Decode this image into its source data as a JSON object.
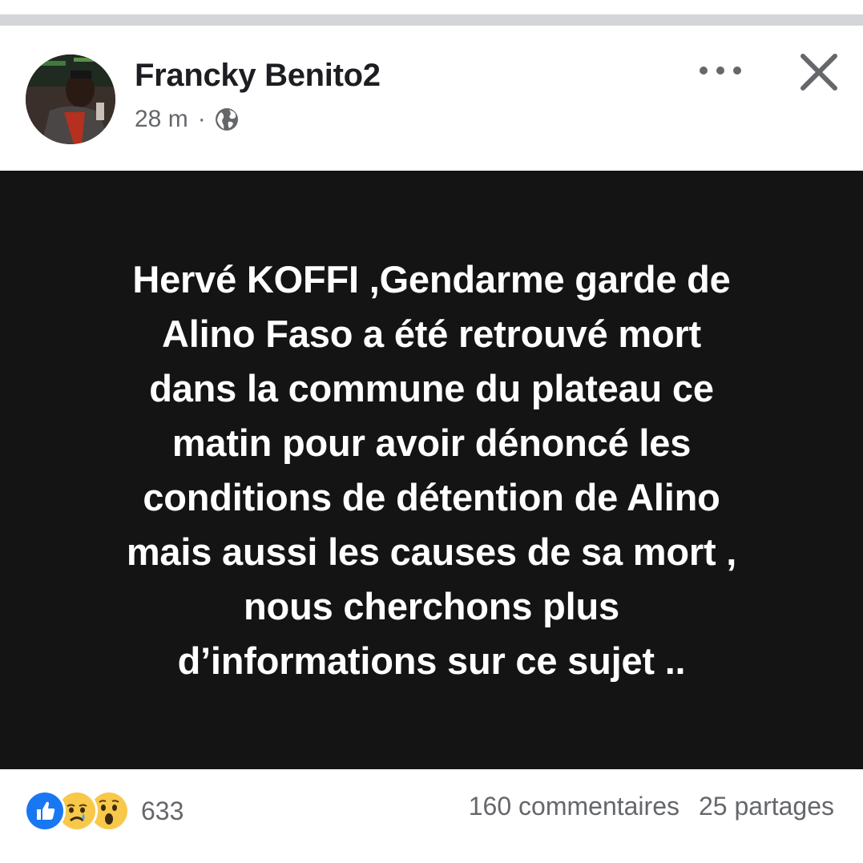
{
  "post": {
    "author": "Francky Benito2",
    "time": "28 m",
    "separator": "·",
    "privacy_icon": "globe-icon",
    "more_icon": "more-options-icon",
    "close_icon": "close-icon",
    "text": "Hervé KOFFI ,Gendarme garde de\nAlino Faso a été retrouvé mort\ndans la commune du plateau ce\nmatin pour avoir dénoncé les\nconditions de détention de Alino\nmais aussi les causes de sa mort ,\nnous cherchons plus\nd’informations sur ce sujet ..",
    "background_color": "#141414"
  },
  "reactions": {
    "icons": [
      "like-icon",
      "sad-icon",
      "wow-icon"
    ],
    "count": "633"
  },
  "stats": {
    "comments": "160 commentaires",
    "shares": "25 partages"
  },
  "colors": {
    "like_blue": "#1877f2",
    "emoji_yellow": "#f7c84a",
    "secondary_text": "#65676b",
    "primary_text": "#1c1e21"
  }
}
